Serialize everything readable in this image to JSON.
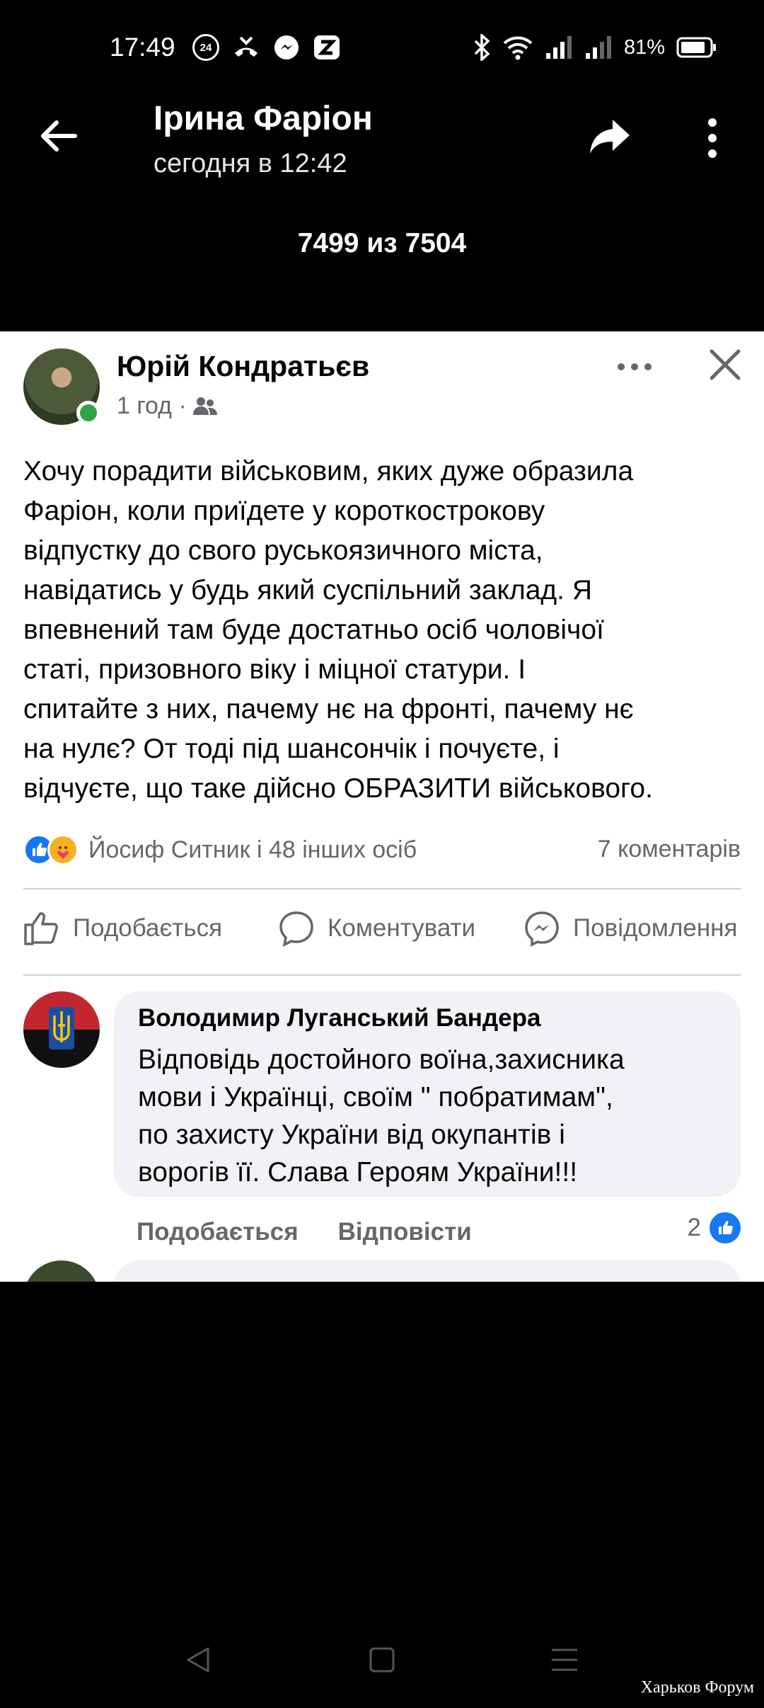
{
  "status_bar": {
    "time": "17:49",
    "notif_badge": "24",
    "battery": "81%",
    "icons": [
      "hd-24-icon",
      "missed-call-icon",
      "messenger-icon",
      "zalo-icon",
      "bluetooth-icon",
      "wifi-icon",
      "signal-icon",
      "signal-icon-2",
      "battery-icon"
    ]
  },
  "header": {
    "title": "Ірина Фаріон",
    "subtitle": "сегодня в 12:42",
    "counter": "7499 из 7504",
    "back_icon": "arrow-left-icon",
    "share_icon": "share-icon",
    "menu_icon": "more-vertical-icon"
  },
  "post": {
    "author": "Юрій Кондратьєв",
    "time": "1 год ·",
    "audience_icon": "friends-icon",
    "text": "Хочу порадити військовим, яких дуже образила\nФаріон, коли приїдете у короткострокову\nвідпустку до свого руськоязичного міста,\nнавідатись у будь який суспільний заклад. Я\nвпевнений там буде достатньо осіб чоловічої\nстаті, призовного віку і міцної статури. І\nспитайте з них, пачему нє на фронті, пачему нє\nна нулє? От тоді  під шансончік і почуєте, і\nвідчуєте, що таке дійсно ОБРАЗИТИ військового.",
    "reactions_text": "Йосиф Ситник і 48 інших осіб",
    "comments_count": "7 коментарів",
    "actions": {
      "like": "Подобається",
      "comment": "Коментувати",
      "message": "Повідомлення"
    }
  },
  "comment": {
    "author": "Володимир Луганський Бандера",
    "text": "Відповідь достойного воїна,захисника\nмови і Українці, своїм \" побратимам\",\nпо захисту України від окупантів і\nворогів її. Слава Героям України!!!",
    "like": "Подобається",
    "reply": "Відповісти",
    "likes": "2"
  },
  "watermark": "Харьков Форум",
  "colors": {
    "facebook_blue": "#1877f2",
    "online_green": "#31a24c",
    "secondary_text": "#65676b",
    "bubble_bg": "#f0f2f5"
  }
}
